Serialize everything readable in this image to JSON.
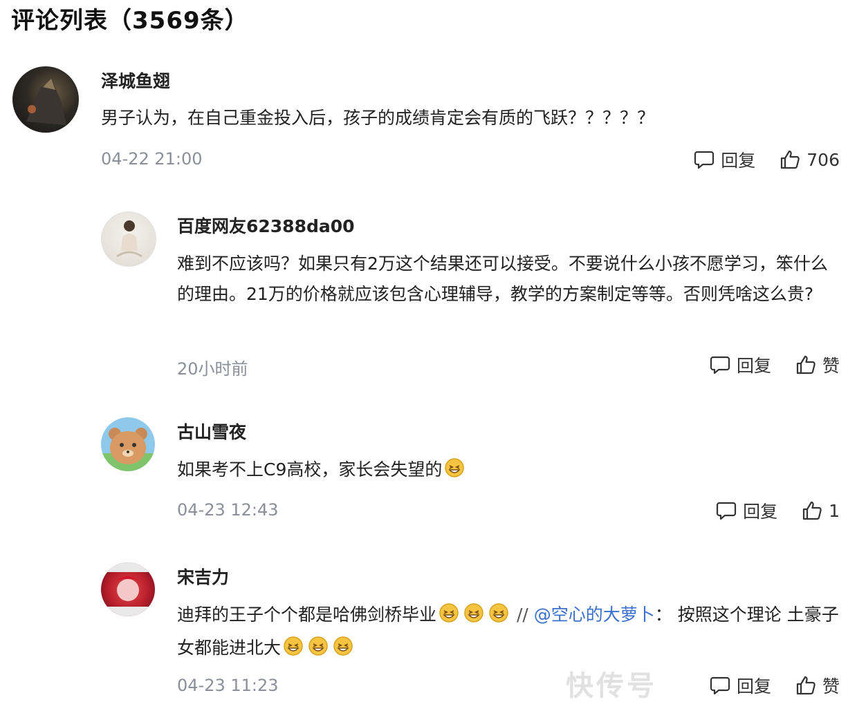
{
  "header": {
    "title": "评论列表（3569条）"
  },
  "comments": [
    {
      "username": "泽城鱼翅",
      "text": "男子认为，在自己重金投入后，孩子的成绩肯定会有质的飞跃？？？？？",
      "time": "04-22 21:00",
      "reply_label": "回复",
      "like_label": "706"
    },
    {
      "username": "百度网友62388da00",
      "text": "难到不应该吗？如果只有2万这个结果还可以接受。不要说什么小孩不愿学习，笨什么的理由。21万的价格就应该包含心理辅导，教学的方案制定等等。否则凭啥这么贵?",
      "time": "20小时前",
      "reply_label": "回复",
      "like_label": "赞"
    },
    {
      "username": "古山雪夜",
      "text": "如果考不上C9高校，家长会失望的",
      "time": "04-23 12:43",
      "reply_label": "回复",
      "like_label": "1"
    },
    {
      "username": "宋吉力",
      "text_part1": "迪拜的王子个个都是哈佛剑桥毕业",
      "separator": "//",
      "mention": "@空心的大萝卜",
      "colon": "：",
      "text_part2": "按照这个理论 土豪子女都能进北大",
      "time": "04-23 11:23",
      "reply_label": "回复",
      "like_label": "赞"
    }
  ],
  "watermark": "快传号",
  "colors": {
    "mention": "#3b6fcf",
    "timestamp": "#8a8f99",
    "emoji": "#f5c542"
  },
  "icons": {
    "reply": "speech-bubble-icon",
    "like": "thumbs-up-icon",
    "emoji": "laughing-emoji-icon"
  }
}
